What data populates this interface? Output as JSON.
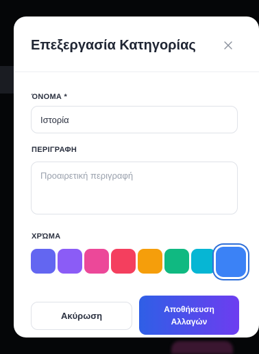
{
  "modal": {
    "title": "Επεξεργασία Κατηγορίας",
    "close_icon": "close-icon"
  },
  "form": {
    "name_label": "ΌΝΟΜΑ *",
    "name_value": "Ιστορία",
    "description_label": "ΠΕΡΙΓΡΑΦΗ",
    "description_value": "",
    "description_placeholder": "Προαιρετική περιγραφή",
    "color_label": "ΧΡΏΜΑ",
    "colors": [
      {
        "hex": "#6366f1",
        "selected": false
      },
      {
        "hex": "#8b5cf6",
        "selected": false
      },
      {
        "hex": "#ec4899",
        "selected": false
      },
      {
        "hex": "#f43f5e",
        "selected": false
      },
      {
        "hex": "#f59e0b",
        "selected": false
      },
      {
        "hex": "#10b981",
        "selected": false
      },
      {
        "hex": "#06b6d4",
        "selected": false
      },
      {
        "hex": "#3b82f6",
        "selected": true
      }
    ]
  },
  "actions": {
    "cancel_label": "Ακύρωση",
    "save_label_line1": "Αποθήκευση",
    "save_label_line2": "Αλλαγών"
  },
  "theme": {
    "accent_start": "#2f5fe6",
    "accent_end": "#6d3df0"
  }
}
